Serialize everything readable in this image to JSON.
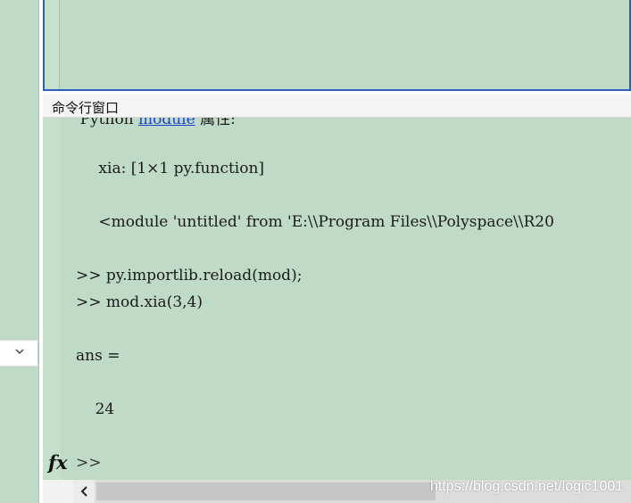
{
  "command_window": {
    "title": "命令行窗口",
    "lines": [
      {
        "prefix": "    Python ",
        "link": "module",
        "suffix": " 属性:"
      },
      {
        "text": "      xia: [1×1 py.function]"
      },
      {
        "text": "      <module 'untitled' from 'E:\\\\Program Files\\\\Polyspace\\\\R20"
      },
      {
        "text": ">> py.importlib.reload(mod);"
      },
      {
        "text": ">> mod.xia(3,4)"
      },
      {
        "text": "ans ="
      },
      {
        "text": "    24"
      }
    ],
    "fx_label": "fx",
    "prompt": ">>"
  },
  "colors": {
    "background": "#bfdbc8",
    "editor_border": "#2e5fbf",
    "link": "#1f3fd1"
  },
  "icons": {
    "dropdown": "chevron-down-icon",
    "scroll_left": "arrow-left-icon"
  },
  "watermark": "https://blog.csdn.net/logic1001"
}
